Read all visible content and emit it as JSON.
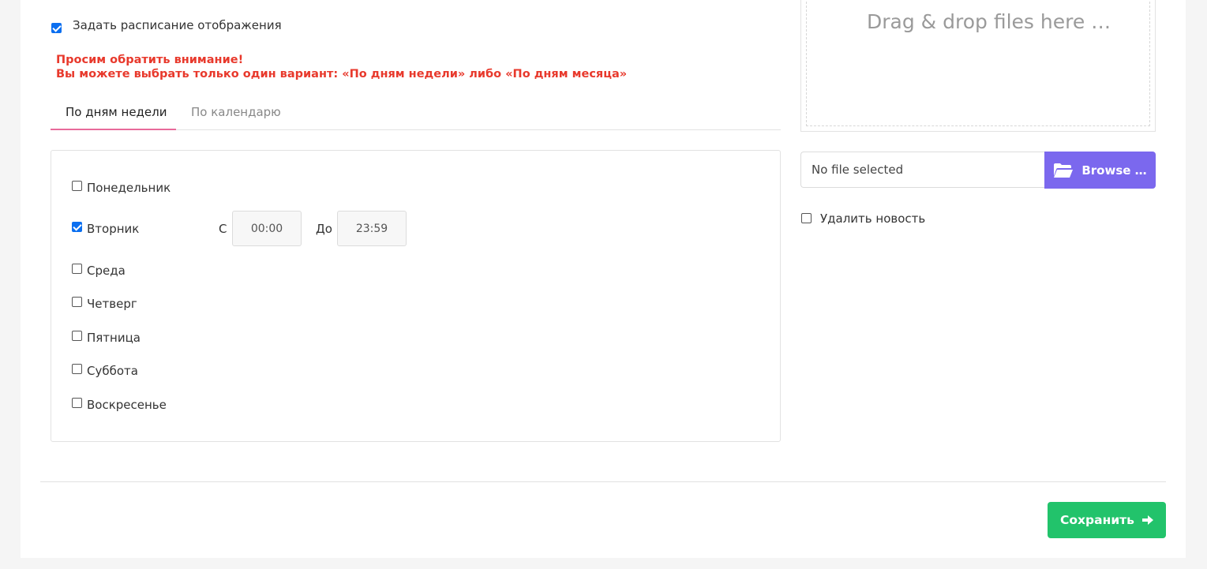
{
  "schedule": {
    "checkbox_label": "Задать расписание отображения",
    "checked": true
  },
  "warning": {
    "line1": "Просим обратить внимание!",
    "line2": "Вы можете выбрать только один вариант: «По дням недели» либо «По дням месяца»"
  },
  "tabs": [
    {
      "label": "По дням недели",
      "active": true
    },
    {
      "label": "По календарю",
      "active": false
    }
  ],
  "days": [
    {
      "label": "Понедельник",
      "checked": false
    },
    {
      "label": "Вторник",
      "checked": true
    },
    {
      "label": "Среда",
      "checked": false
    },
    {
      "label": "Четверг",
      "checked": false
    },
    {
      "label": "Пятница",
      "checked": false
    },
    {
      "label": "Суббота",
      "checked": false
    },
    {
      "label": "Воскресенье",
      "checked": false
    }
  ],
  "time_range": {
    "from_label": "С",
    "from_value": "00:00",
    "to_label": "До",
    "to_value": "23:59"
  },
  "upload": {
    "dropzone_text": "Drag & drop files here …",
    "file_status": "No file selected",
    "browse_label": "Browse …",
    "browse_icon": "folder-open-icon"
  },
  "delete_news": {
    "label": "Удалить новость",
    "checked": false
  },
  "save": {
    "label": "Сохранить",
    "icon": "arrow-right-icon"
  },
  "colors": {
    "warning": "#e8392c",
    "browse": "#7b68ee",
    "save": "#22c36b",
    "tab_indicator": "#e86a9a",
    "checkbox_checked": "#0b6ff0"
  }
}
